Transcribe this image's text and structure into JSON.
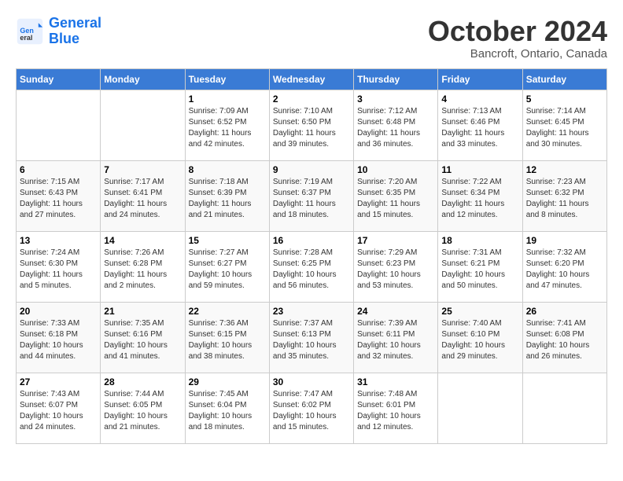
{
  "header": {
    "logo_line1": "General",
    "logo_line2": "Blue",
    "month_title": "October 2024",
    "subtitle": "Bancroft, Ontario, Canada"
  },
  "weekdays": [
    "Sunday",
    "Monday",
    "Tuesday",
    "Wednesday",
    "Thursday",
    "Friday",
    "Saturday"
  ],
  "weeks": [
    [
      {
        "day": "",
        "sunrise": "",
        "sunset": "",
        "daylight": ""
      },
      {
        "day": "",
        "sunrise": "",
        "sunset": "",
        "daylight": ""
      },
      {
        "day": "1",
        "sunrise": "Sunrise: 7:09 AM",
        "sunset": "Sunset: 6:52 PM",
        "daylight": "Daylight: 11 hours and 42 minutes."
      },
      {
        "day": "2",
        "sunrise": "Sunrise: 7:10 AM",
        "sunset": "Sunset: 6:50 PM",
        "daylight": "Daylight: 11 hours and 39 minutes."
      },
      {
        "day": "3",
        "sunrise": "Sunrise: 7:12 AM",
        "sunset": "Sunset: 6:48 PM",
        "daylight": "Daylight: 11 hours and 36 minutes."
      },
      {
        "day": "4",
        "sunrise": "Sunrise: 7:13 AM",
        "sunset": "Sunset: 6:46 PM",
        "daylight": "Daylight: 11 hours and 33 minutes."
      },
      {
        "day": "5",
        "sunrise": "Sunrise: 7:14 AM",
        "sunset": "Sunset: 6:45 PM",
        "daylight": "Daylight: 11 hours and 30 minutes."
      }
    ],
    [
      {
        "day": "6",
        "sunrise": "Sunrise: 7:15 AM",
        "sunset": "Sunset: 6:43 PM",
        "daylight": "Daylight: 11 hours and 27 minutes."
      },
      {
        "day": "7",
        "sunrise": "Sunrise: 7:17 AM",
        "sunset": "Sunset: 6:41 PM",
        "daylight": "Daylight: 11 hours and 24 minutes."
      },
      {
        "day": "8",
        "sunrise": "Sunrise: 7:18 AM",
        "sunset": "Sunset: 6:39 PM",
        "daylight": "Daylight: 11 hours and 21 minutes."
      },
      {
        "day": "9",
        "sunrise": "Sunrise: 7:19 AM",
        "sunset": "Sunset: 6:37 PM",
        "daylight": "Daylight: 11 hours and 18 minutes."
      },
      {
        "day": "10",
        "sunrise": "Sunrise: 7:20 AM",
        "sunset": "Sunset: 6:35 PM",
        "daylight": "Daylight: 11 hours and 15 minutes."
      },
      {
        "day": "11",
        "sunrise": "Sunrise: 7:22 AM",
        "sunset": "Sunset: 6:34 PM",
        "daylight": "Daylight: 11 hours and 12 minutes."
      },
      {
        "day": "12",
        "sunrise": "Sunrise: 7:23 AM",
        "sunset": "Sunset: 6:32 PM",
        "daylight": "Daylight: 11 hours and 8 minutes."
      }
    ],
    [
      {
        "day": "13",
        "sunrise": "Sunrise: 7:24 AM",
        "sunset": "Sunset: 6:30 PM",
        "daylight": "Daylight: 11 hours and 5 minutes."
      },
      {
        "day": "14",
        "sunrise": "Sunrise: 7:26 AM",
        "sunset": "Sunset: 6:28 PM",
        "daylight": "Daylight: 11 hours and 2 minutes."
      },
      {
        "day": "15",
        "sunrise": "Sunrise: 7:27 AM",
        "sunset": "Sunset: 6:27 PM",
        "daylight": "Daylight: 10 hours and 59 minutes."
      },
      {
        "day": "16",
        "sunrise": "Sunrise: 7:28 AM",
        "sunset": "Sunset: 6:25 PM",
        "daylight": "Daylight: 10 hours and 56 minutes."
      },
      {
        "day": "17",
        "sunrise": "Sunrise: 7:29 AM",
        "sunset": "Sunset: 6:23 PM",
        "daylight": "Daylight: 10 hours and 53 minutes."
      },
      {
        "day": "18",
        "sunrise": "Sunrise: 7:31 AM",
        "sunset": "Sunset: 6:21 PM",
        "daylight": "Daylight: 10 hours and 50 minutes."
      },
      {
        "day": "19",
        "sunrise": "Sunrise: 7:32 AM",
        "sunset": "Sunset: 6:20 PM",
        "daylight": "Daylight: 10 hours and 47 minutes."
      }
    ],
    [
      {
        "day": "20",
        "sunrise": "Sunrise: 7:33 AM",
        "sunset": "Sunset: 6:18 PM",
        "daylight": "Daylight: 10 hours and 44 minutes."
      },
      {
        "day": "21",
        "sunrise": "Sunrise: 7:35 AM",
        "sunset": "Sunset: 6:16 PM",
        "daylight": "Daylight: 10 hours and 41 minutes."
      },
      {
        "day": "22",
        "sunrise": "Sunrise: 7:36 AM",
        "sunset": "Sunset: 6:15 PM",
        "daylight": "Daylight: 10 hours and 38 minutes."
      },
      {
        "day": "23",
        "sunrise": "Sunrise: 7:37 AM",
        "sunset": "Sunset: 6:13 PM",
        "daylight": "Daylight: 10 hours and 35 minutes."
      },
      {
        "day": "24",
        "sunrise": "Sunrise: 7:39 AM",
        "sunset": "Sunset: 6:11 PM",
        "daylight": "Daylight: 10 hours and 32 minutes."
      },
      {
        "day": "25",
        "sunrise": "Sunrise: 7:40 AM",
        "sunset": "Sunset: 6:10 PM",
        "daylight": "Daylight: 10 hours and 29 minutes."
      },
      {
        "day": "26",
        "sunrise": "Sunrise: 7:41 AM",
        "sunset": "Sunset: 6:08 PM",
        "daylight": "Daylight: 10 hours and 26 minutes."
      }
    ],
    [
      {
        "day": "27",
        "sunrise": "Sunrise: 7:43 AM",
        "sunset": "Sunset: 6:07 PM",
        "daylight": "Daylight: 10 hours and 24 minutes."
      },
      {
        "day": "28",
        "sunrise": "Sunrise: 7:44 AM",
        "sunset": "Sunset: 6:05 PM",
        "daylight": "Daylight: 10 hours and 21 minutes."
      },
      {
        "day": "29",
        "sunrise": "Sunrise: 7:45 AM",
        "sunset": "Sunset: 6:04 PM",
        "daylight": "Daylight: 10 hours and 18 minutes."
      },
      {
        "day": "30",
        "sunrise": "Sunrise: 7:47 AM",
        "sunset": "Sunset: 6:02 PM",
        "daylight": "Daylight: 10 hours and 15 minutes."
      },
      {
        "day": "31",
        "sunrise": "Sunrise: 7:48 AM",
        "sunset": "Sunset: 6:01 PM",
        "daylight": "Daylight: 10 hours and 12 minutes."
      },
      {
        "day": "",
        "sunrise": "",
        "sunset": "",
        "daylight": ""
      },
      {
        "day": "",
        "sunrise": "",
        "sunset": "",
        "daylight": ""
      }
    ]
  ]
}
